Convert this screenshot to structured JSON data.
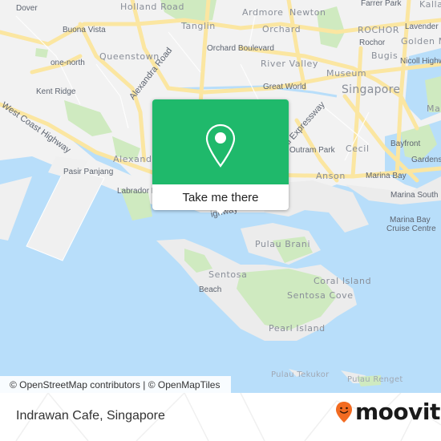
{
  "map": {
    "labels": {
      "dover": "Dover",
      "holland_road": "Holland Road",
      "buona_vista": "Buona Vista",
      "tanglin": "Tanglin",
      "queenstown": "Queenstown",
      "one_north": "one-north",
      "kent_ridge": "Kent Ridge",
      "orchard": "Orchard",
      "orchard_boulevard": "Orchard Boulevard",
      "ardmore": "Ardmore",
      "newton": "Newton",
      "farrer_park": "Farrer Park",
      "kallang": "Kalla",
      "rochor_district": "ROCHOR",
      "rochor": "Rochor",
      "lavender": "Lavender",
      "golden_mile": "Golden M",
      "bugis": "Bugis",
      "nicoll_highway": "Nicoll Highw",
      "river_valley": "River Valley",
      "museum": "Museum",
      "great_world": "Great World",
      "singapore": "Singapore",
      "alexandra_road": "Alexandra Road",
      "west_coast_highway": "West Coast Highway",
      "alexandra": "Alexandr",
      "pasir_panjang": "Pasir Panjang",
      "labrador": "Labrador P",
      "expressway": "al Expressway",
      "outram_park": "Outram Park",
      "cecil": "Cecil",
      "anson": "Anson",
      "bayfront": "Bayfront",
      "gardens": "Gardens",
      "marina": "Mar",
      "marina_bay": "Marina Bay",
      "marina_south_pier": "Marina South Pi",
      "marina_bay_cruise_1": "Marina Bay",
      "marina_bay_cruise_2": "Cruise Centre",
      "highway_fragment": "ighway",
      "pulau_brani": "Pulau Brani",
      "sentosa": "Sentosa",
      "beach": "Beach",
      "coral_island": "Coral Island",
      "sentosa_cove": "Sentosa Cove",
      "pearl_island": "Pearl Island",
      "pulau_tekukor": "Pulau Tekukor",
      "pulau_renget": "Pulau Renget"
    },
    "popup": {
      "icon": "map-pin-icon",
      "cta_label": "Take me there",
      "accent_color": "#1fb96b"
    },
    "attribution": "© OpenStreetMap contributors | © OpenMapTiles"
  },
  "footer": {
    "place_name": "Indrawan Cafe, Singapore",
    "brand": {
      "name": "moovit",
      "icon": "moovit-pin-smile-icon",
      "color": "#f26b21"
    }
  }
}
